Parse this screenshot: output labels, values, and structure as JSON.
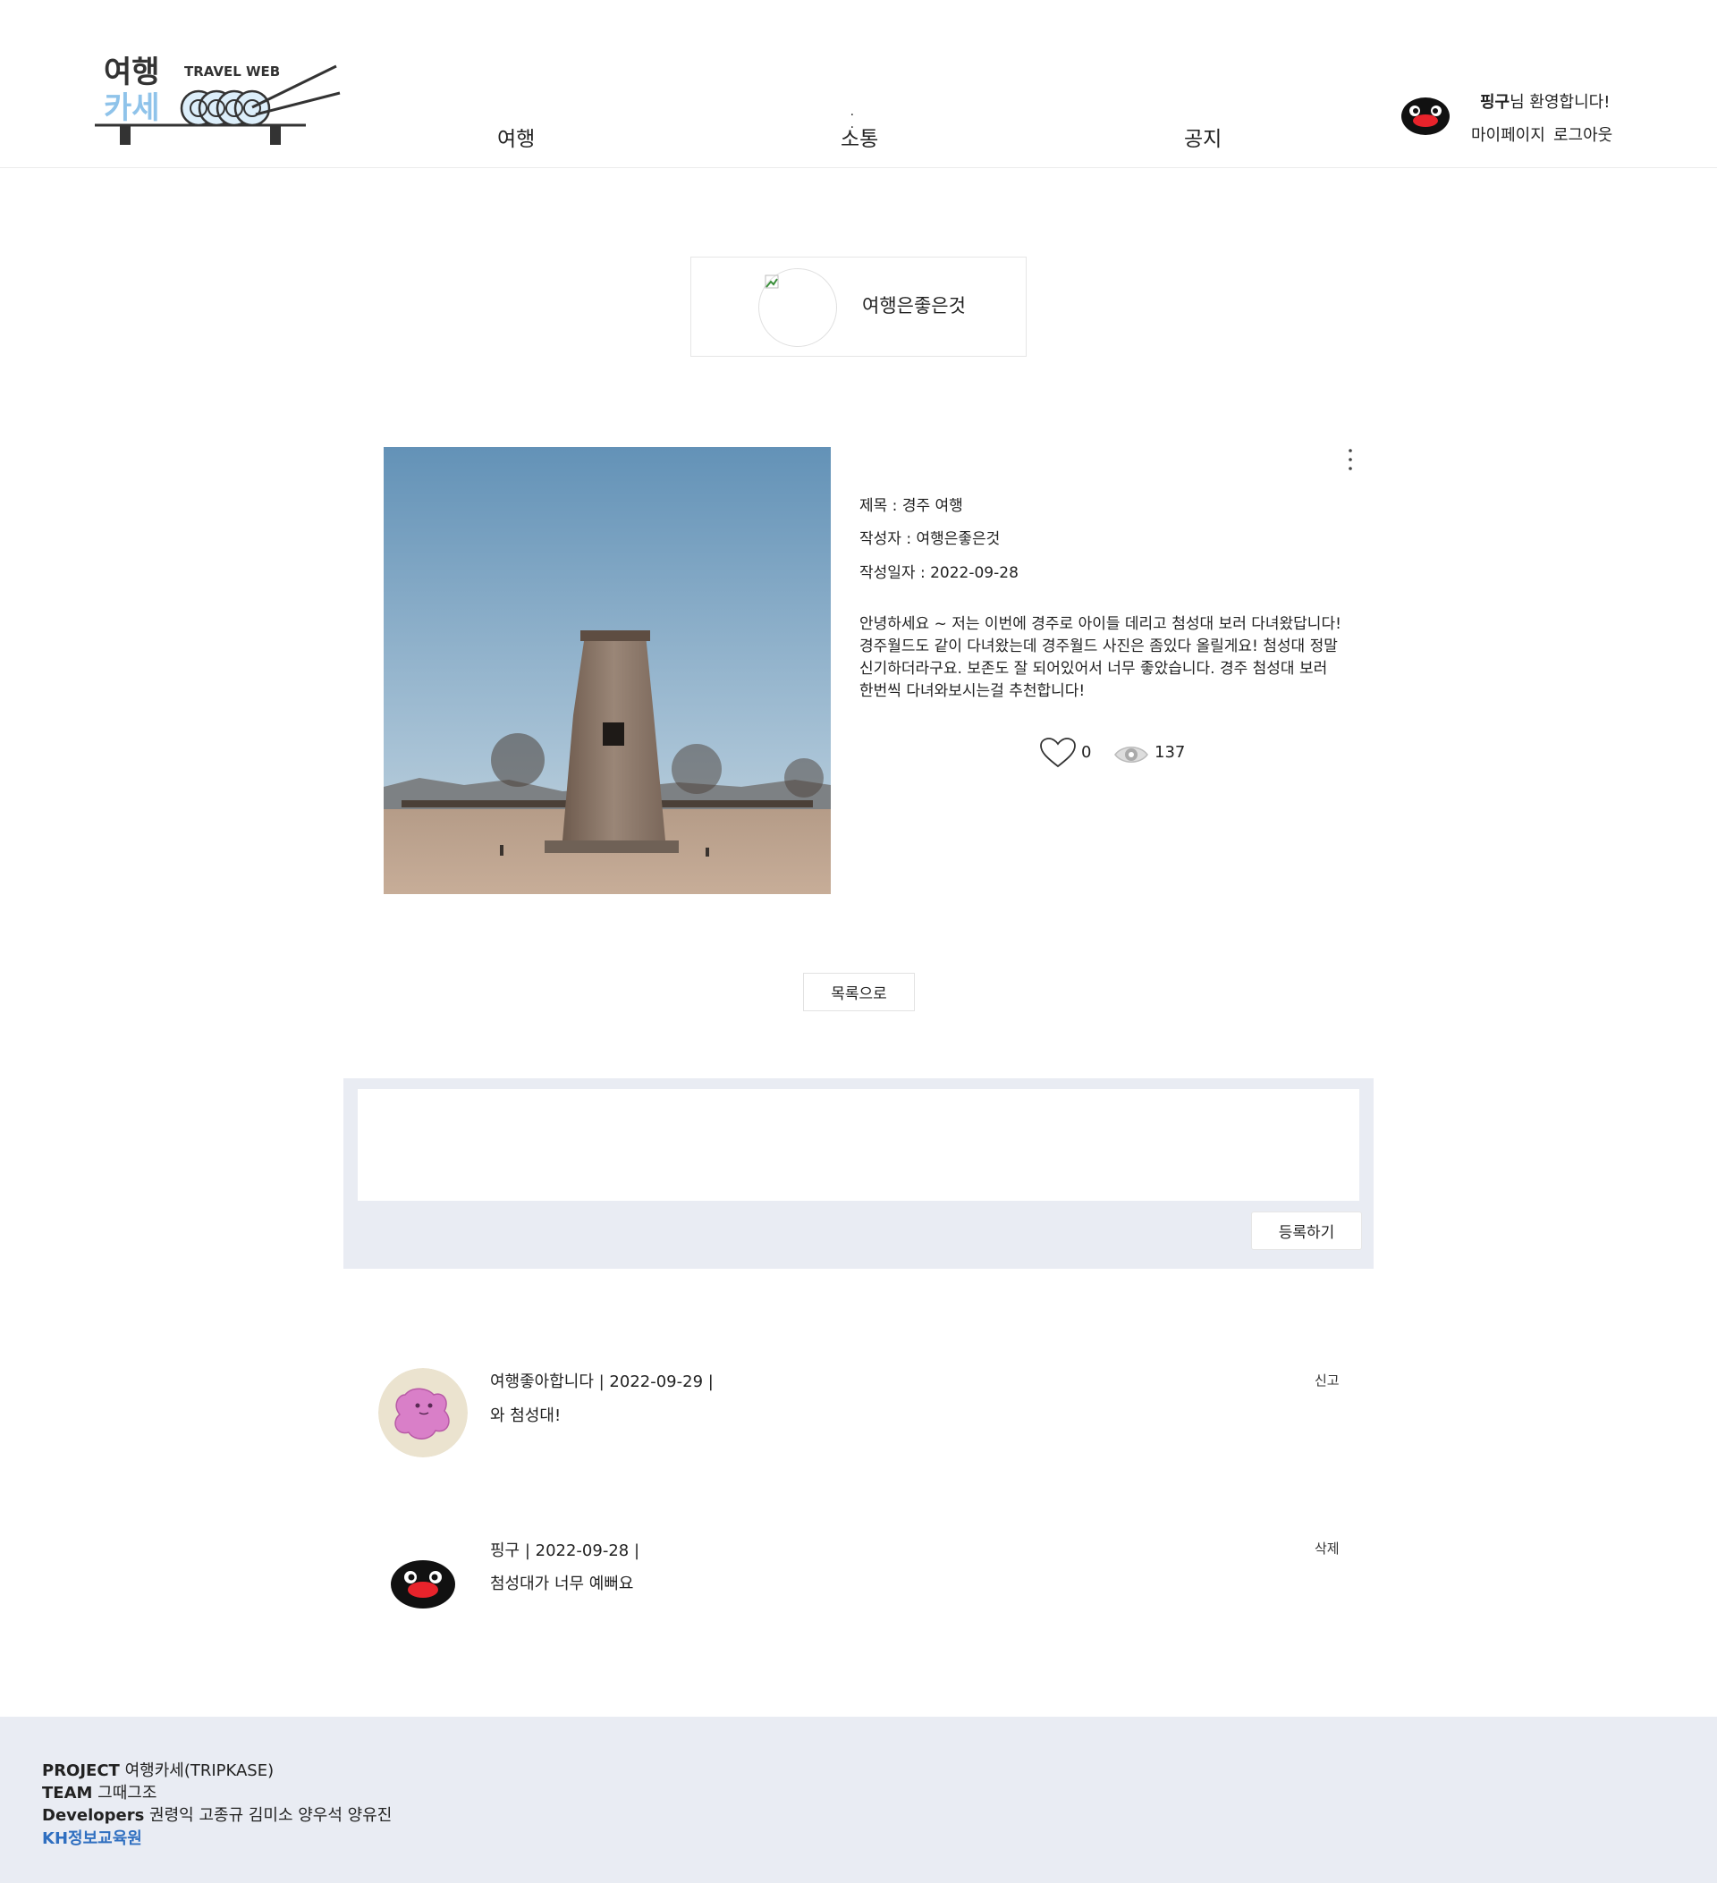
{
  "header": {
    "logo": {
      "line1": "여행",
      "line2": "카세",
      "tag": "TRAVEL WEB"
    },
    "nav": [
      {
        "label": "여행"
      },
      {
        "label": "소통",
        "active_marker": "· ·"
      },
      {
        "label": "공지"
      }
    ],
    "user": {
      "name": "핑구",
      "greeting": "님 환영합니다!",
      "mypage_label": "마이페이지",
      "logout_label": "로그아웃"
    }
  },
  "author_box": {
    "name": "여행은좋은것"
  },
  "post": {
    "title_line": "제목 : 경주 여행",
    "writer_line": "작성자 : 여행은좋은것",
    "date_line": "작성일자 : 2022-09-28",
    "content": "안녕하세요 ~ 저는 이번에 경주로 아이들 데리고 첨성대 보러 다녀왔답니다! 경주월드도 같이 다녀왔는데 경주월드 사진은 좀있다 올릴게요! 첨성대 정말 신기하더라구요. 보존도 잘 되어있어서 너무 좋았습니다. 경주 첨성대 보러 한번씩 다녀와보시는걸 추천합니다!",
    "likes": "0",
    "views": "137"
  },
  "list_button_label": "목록으로",
  "comment_form": {
    "textarea_value": "",
    "submit_label": "등록하기"
  },
  "comments": [
    {
      "meta": "여행좋아합니다 | 2022-09-29 |",
      "text": "와 첨성대!",
      "action": "신고",
      "avatar": "pink-blob-avatar"
    },
    {
      "meta": "핑구 | 2022-09-28 |",
      "text": "첨성대가 너무 예뻐요",
      "action": "삭제",
      "avatar": "pingu-avatar"
    }
  ],
  "footer": {
    "project_label": "PROJECT",
    "project_value": "여행카세(TRIPKASE)",
    "team_label": "TEAM",
    "team_value": "그때그조",
    "developers_label": "Developers",
    "developers_value": "권령익 고종규 김미소 양우석 양유진",
    "link_label": "KH정보교육원"
  },
  "colors": {
    "footer_bg": "#e9ecf3",
    "link_blue": "#2f6fc0",
    "logo_blue": "#8fc3ea",
    "logo_dark": "#333333"
  }
}
